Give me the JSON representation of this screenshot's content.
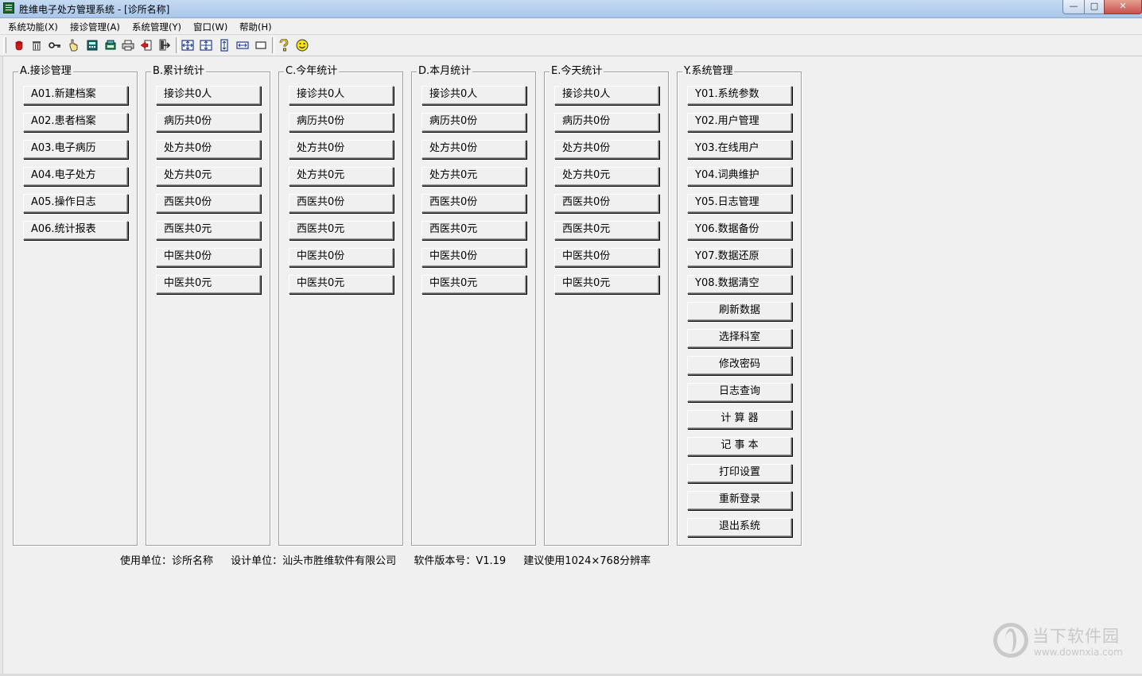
{
  "window": {
    "title": "胜维电子处方管理系统 - [诊所名称]",
    "min_glyph": "—",
    "max_glyph": "□",
    "close_glyph": "✕"
  },
  "menu": [
    "系统功能(X)",
    "接诊管理(A)",
    "系统管理(Y)",
    "窗口(W)",
    "帮助(H)"
  ],
  "toolbar_icons": [
    "stop-hand-icon",
    "trash-icon",
    "key-icon",
    "pointing-hand-icon",
    "calculator-icon",
    "refresh-icon",
    "printer-icon",
    "exit-icon",
    "logout-icon",
    "cascade-icon",
    "tile-icon",
    "tile-vertical-icon",
    "tile-horizontal-icon",
    "restore-icon",
    "help-icon",
    "smiley-icon"
  ],
  "groups": {
    "a": {
      "title": "A.接诊管理",
      "buttons": [
        "A01.新建档案",
        "A02.患者档案",
        "A03.电子病历",
        "A04.电子处方",
        "A05.操作日志",
        "A06.统计报表"
      ]
    },
    "b": {
      "title": "B.累计统计",
      "buttons": [
        "接诊共0人",
        "病历共0份",
        "处方共0份",
        "处方共0元",
        "西医共0份",
        "西医共0元",
        "中医共0份",
        "中医共0元"
      ]
    },
    "c": {
      "title": "C.今年统计",
      "buttons": [
        "接诊共0人",
        "病历共0份",
        "处方共0份",
        "处方共0元",
        "西医共0份",
        "西医共0元",
        "中医共0份",
        "中医共0元"
      ]
    },
    "d": {
      "title": "D.本月统计",
      "buttons": [
        "接诊共0人",
        "病历共0份",
        "处方共0份",
        "处方共0元",
        "西医共0份",
        "西医共0元",
        "中医共0份",
        "中医共0元"
      ]
    },
    "e": {
      "title": "E.今天统计",
      "buttons": [
        "接诊共0人",
        "病历共0份",
        "处方共0份",
        "处方共0元",
        "西医共0份",
        "西医共0元",
        "中医共0份",
        "中医共0元"
      ]
    },
    "y": {
      "title": "Y.系统管理",
      "buttons": [
        "Y01.系统参数",
        "Y02.用户管理",
        "Y03.在线用户",
        "Y04.词典维护",
        "Y05.日志管理",
        "Y06.数据备份",
        "Y07.数据还原",
        "Y08.数据清空"
      ],
      "extra_buttons": [
        "刷新数据",
        "选择科室",
        "修改密码",
        "日志查询",
        "计 算 器",
        "记 事 本",
        "打印设置",
        "重新登录",
        "退出系统"
      ]
    }
  },
  "footer": {
    "user_unit": "使用单位：诊所名称",
    "designer": "设计单位：汕头市胜维软件有限公司",
    "version": "软件版本号：V1.19",
    "resolution": "建议使用1024×768分辨率"
  },
  "watermark": {
    "cn": "当下软件园",
    "en": "www.downxia.com"
  }
}
